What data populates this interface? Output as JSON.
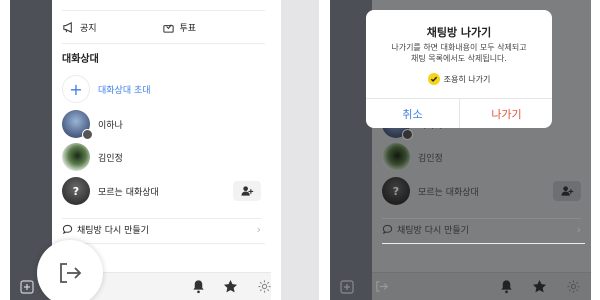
{
  "menu": {
    "notice_label": "공지",
    "vote_label": "투표",
    "section_title": "대화상대",
    "invite_label": "대화상대 초대",
    "members": [
      {
        "name": "이하나"
      },
      {
        "name": "김인정"
      },
      {
        "name": "모르는 대화상대",
        "avatar_glyph": "?"
      }
    ],
    "recreate_label": "채팅방 다시 만들기"
  },
  "dialog": {
    "title": "채팅방 나가기",
    "message_line1": "나가기를 하면 대화내용이 모두 삭제되고",
    "message_line2": "채팅 목록에서도 삭제됩니다.",
    "checkbox_label": "조용히 나가기",
    "checkbox_checked": true,
    "cancel_label": "취소",
    "leave_label": "나가기"
  },
  "colors": {
    "accent_blue": "#3c7fe6",
    "leave_red": "#e3563c",
    "check_yellow": "#f7d31a"
  }
}
